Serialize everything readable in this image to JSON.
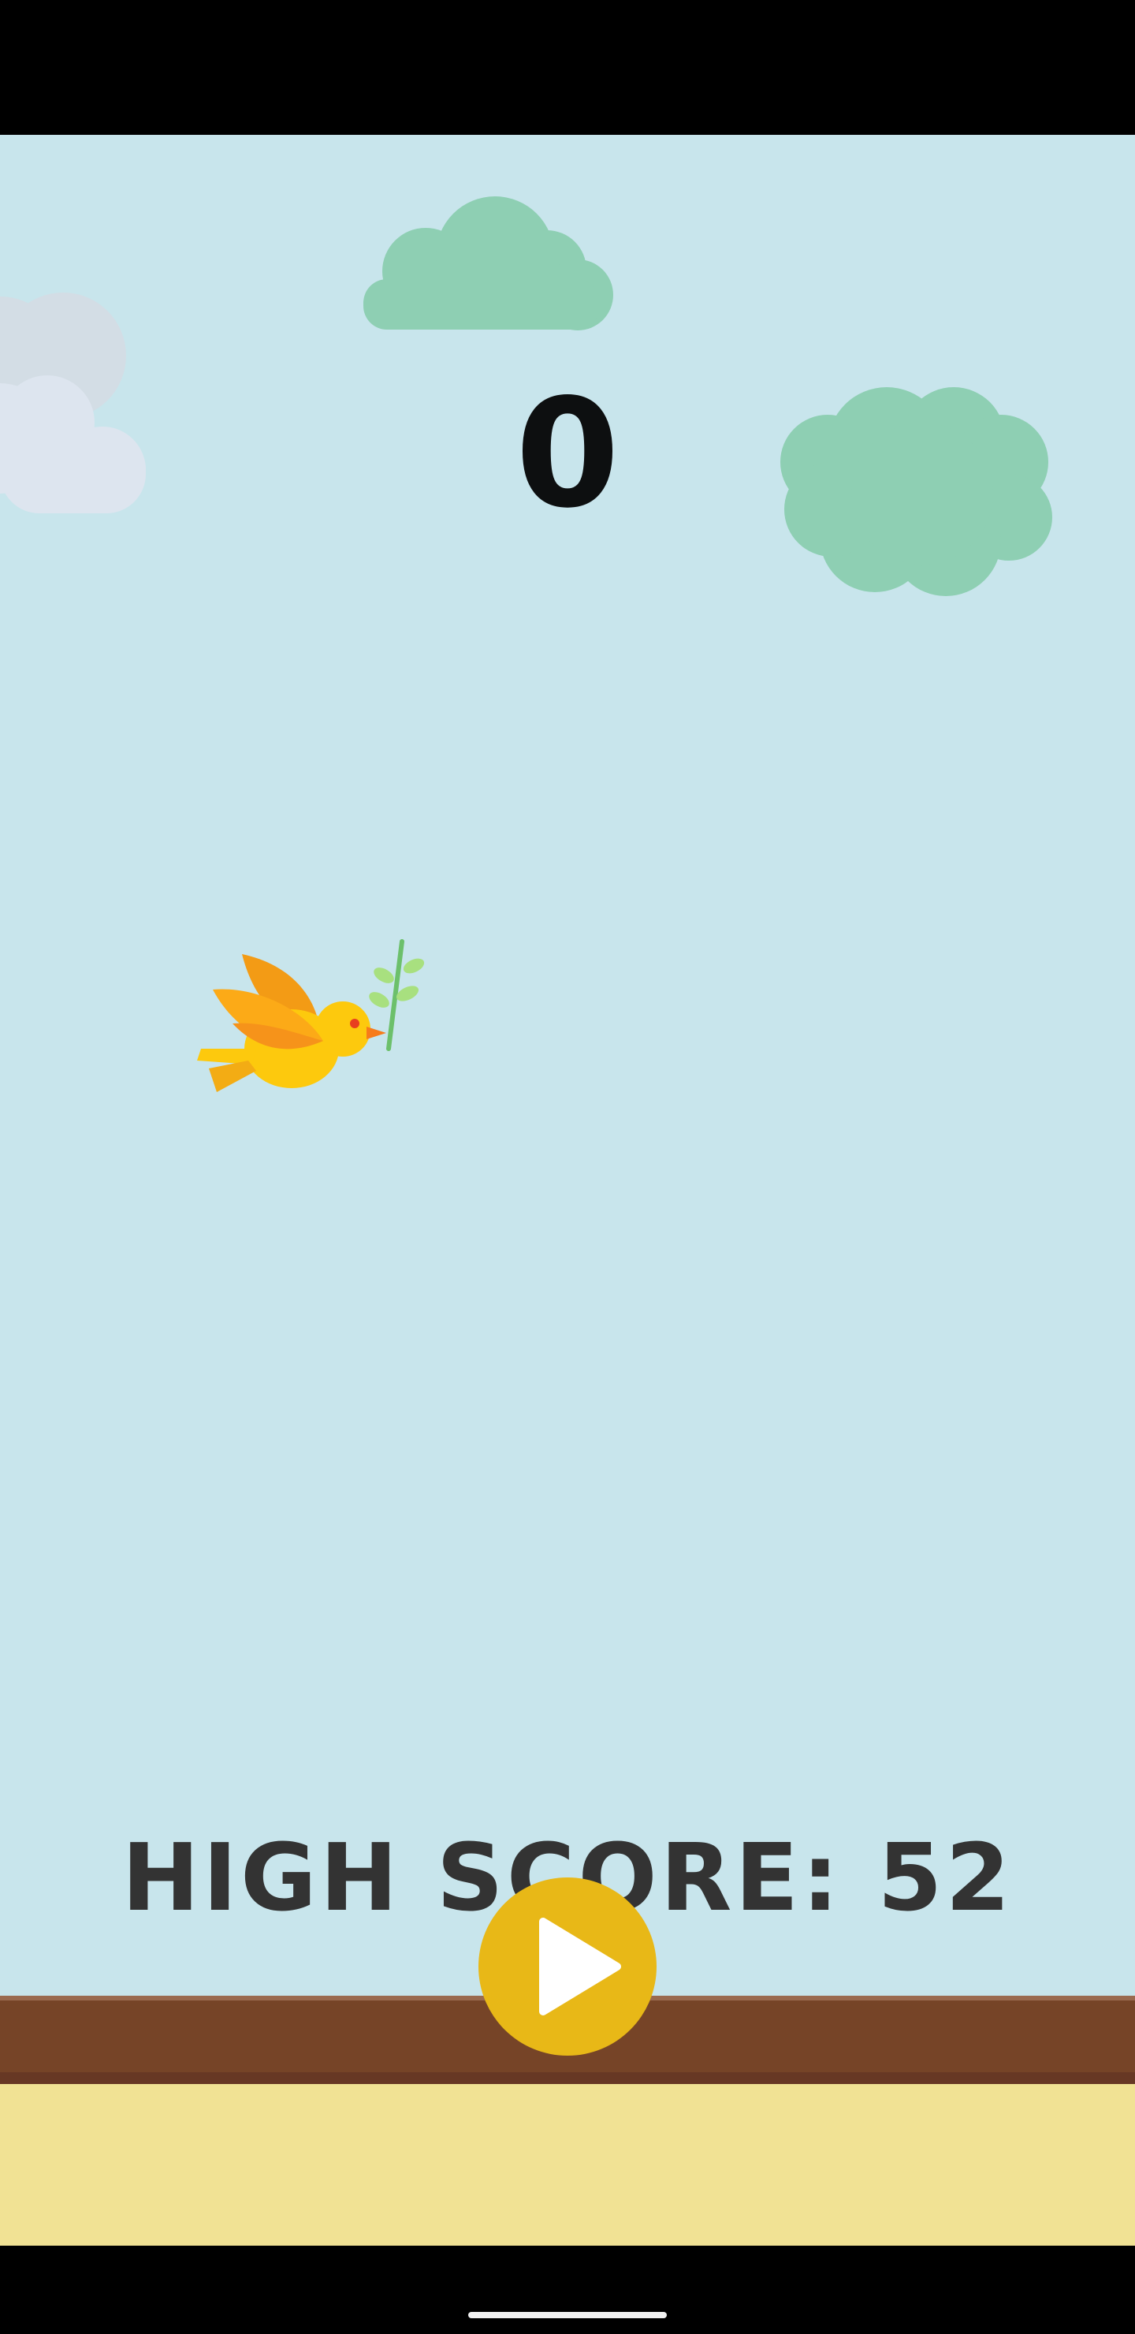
{
  "game": {
    "current_score": "0",
    "high_score_label": "HIGH SCORE: 52",
    "play_button_icon": "play-icon",
    "player_sprite": "bird-with-olive-branch"
  },
  "colors": {
    "sky": "#c8e5ec",
    "cloud_green": "#8ecfb3",
    "cloud_grey": "#dde5ef",
    "score_text": "#0d0f10",
    "high_score_text": "#333333",
    "play_button": "#e8b817",
    "ground_dirt": "#764427",
    "ground_sand": "#f1e294"
  }
}
